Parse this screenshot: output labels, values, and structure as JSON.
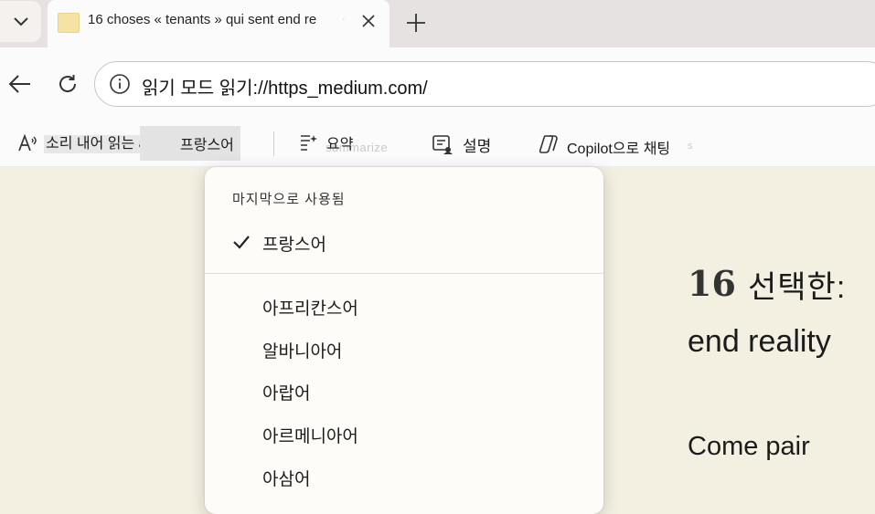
{
  "tab": {
    "title": "16 choses « tenants » qui sent end re",
    "separator": "·"
  },
  "address_bar": {
    "url": "읽기 모드 읽기://https_medium.com/"
  },
  "reader_toolbar": {
    "read_aloud_label": "소리 내어 읽는 ab",
    "language_select_faint": "",
    "language_select_value": "프랑스어",
    "summarize_label": "요약",
    "summarize_ghost": "summarize",
    "explain_label": "설명",
    "copilot_label": "Copilot으로 채팅",
    "copilot_ghost": "s"
  },
  "article": {
    "number": "16",
    "heading": "선택한:",
    "line2": "end reality",
    "paragraph": "Come pair"
  },
  "language_dropdown": {
    "recent_header": "마지막으로 사용됨",
    "selected": "프랑스어",
    "languages": [
      "아프리칸스어",
      "알바니아어",
      "아랍어",
      "아르메니아어",
      "아삼어"
    ]
  }
}
